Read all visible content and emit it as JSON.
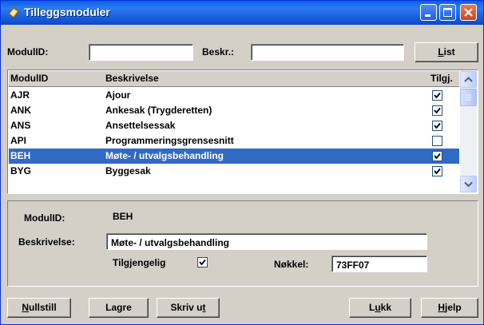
{
  "window": {
    "title": "Tilleggsmoduler"
  },
  "search": {
    "modulid_label": "ModulID:",
    "modulid_value": "",
    "beskr_label": "Beskr.:",
    "beskr_value": "",
    "list_button": {
      "pre": "",
      "u": "L",
      "post": "ist"
    }
  },
  "list": {
    "columns": [
      "ModulID",
      "Beskrivelse",
      "Tilgj."
    ],
    "rows": [
      {
        "id": "AJR",
        "desc": "Ajour",
        "available": true,
        "selected": false
      },
      {
        "id": "ANK",
        "desc": "Ankesak (Trygderetten)",
        "available": true,
        "selected": false
      },
      {
        "id": "ANS",
        "desc": "Ansettelsessak",
        "available": true,
        "selected": false
      },
      {
        "id": "API",
        "desc": "Programmeringsgrensesnitt",
        "available": false,
        "selected": false
      },
      {
        "id": "BEH",
        "desc": "Møte- / utvalgsbehandling",
        "available": true,
        "selected": true
      },
      {
        "id": "BYG",
        "desc": "Byggesak",
        "available": true,
        "selected": false
      }
    ]
  },
  "detail": {
    "modulid_label": "ModulID:",
    "modulid_value": "BEH",
    "beskrivelse_label": "Beskrivelse:",
    "beskrivelse_value": "Møte- / utvalgsbehandling",
    "tilgjengelig_label": "Tilgjengelig",
    "tilgjengelig_checked": true,
    "nokkel_label": "Nøkkel:",
    "nokkel_value": "73FF07"
  },
  "buttons": {
    "nullstill": {
      "pre": "",
      "u": "N",
      "post": "ullstill"
    },
    "lagre": {
      "pre": "La",
      "u": "g",
      "post": "re"
    },
    "skriv_ut": {
      "pre": "Skriv u",
      "u": "t",
      "post": ""
    },
    "lukk": {
      "pre": "L",
      "u": "u",
      "post": "kk"
    },
    "hjelp": {
      "pre": "",
      "u": "H",
      "post": "jelp"
    }
  },
  "colors": {
    "selection": "#316ac5",
    "titlebar": "#0a5fe6"
  }
}
